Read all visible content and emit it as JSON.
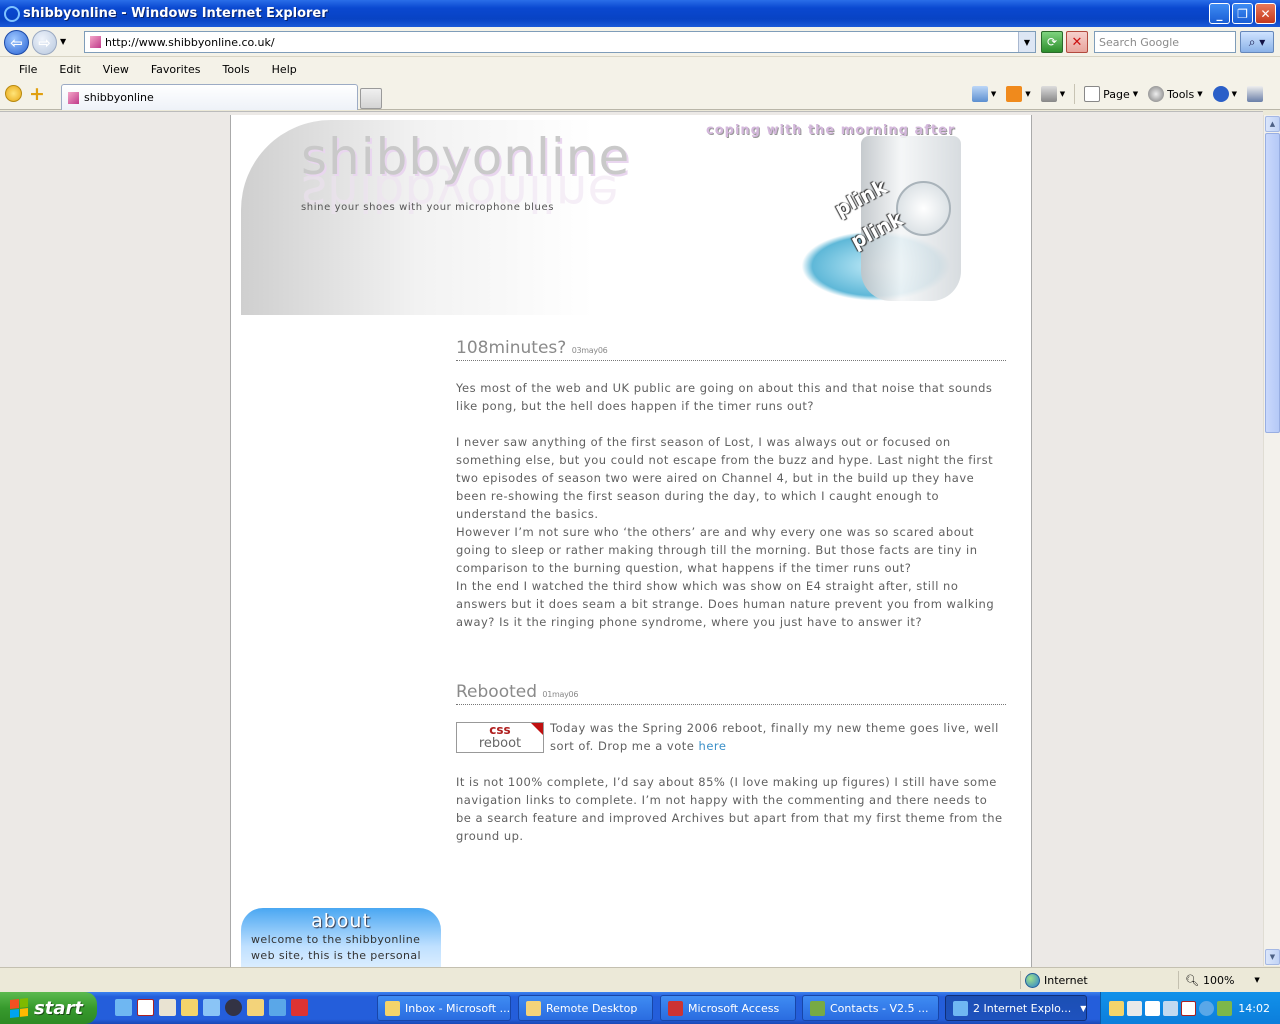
{
  "window": {
    "title": "shibbyonline - Windows Internet Explorer"
  },
  "address": {
    "url": "http://www.shibbyonline.co.uk/"
  },
  "search": {
    "placeholder": "Search Google"
  },
  "menu": [
    "File",
    "Edit",
    "View",
    "Favorites",
    "Tools",
    "Help"
  ],
  "tab": {
    "title": "shibbyonline"
  },
  "command_bar": {
    "page_label": "Page",
    "tools_label": "Tools"
  },
  "site": {
    "name": "shibbyonline",
    "tagline": "shine your shoes with your microphone blues",
    "banner_text": "coping with the morning after",
    "plink1": "plink",
    "plink2": "plink"
  },
  "posts": [
    {
      "title": "108minutes?",
      "date": "03may06",
      "paragraphs": [
        "Yes most of the web and UK public are going on about this and that noise that sounds like pong, but the hell does happen if the timer runs out?",
        "I never saw anything of the first season of Lost, I was always out or focused on something else, but you could not escape from the buzz and hype. Last night the first two episodes of season two were aired on Channel 4, but in the build up they have been re-showing the first season during the day, to which I caught enough to understand the basics.",
        "However I’m not sure who ‘the others’ are and why every one was so scared about going to sleep or rather making through till the morning. But those facts are tiny in comparison to the burning question, what happens if the timer runs out?",
        "In the end I watched the third show which was show on E4 straight after, still no answers but it does seam a bit strange. Does human nature prevent you from walking away? Is it the ringing phone syndrome, where you just have to answer it?"
      ]
    },
    {
      "title": "Rebooted",
      "date": "01may06",
      "badge_top": "css",
      "badge_bottom": "reboot",
      "intro": "Today was the Spring 2006 reboot, finally my new theme goes live, well sort of. Drop me a vote ",
      "link_text": "here",
      "paragraphs": [
        "It is not 100% complete, I’d say about 85% (I love making up figures) I still have some navigation links to complete. I’m not happy with the commenting and there needs to be a search feature and improved Archives but apart from that my first theme from the ground up."
      ]
    }
  ],
  "about": {
    "title": "about",
    "text": "welcome to the shibbyonline web site, this is the personal online"
  },
  "status": {
    "zone": "Internet",
    "zoom": "100%"
  },
  "taskbar": {
    "start": "start",
    "buttons": [
      "Inbox - Microsoft ...",
      "Remote Desktop",
      "Microsoft Access",
      "Contacts -  V2.5 ...",
      "2 Internet Explo..."
    ],
    "clock": "14:02"
  },
  "colors": {
    "title_bar": "#0843c4",
    "taskbar": "#245edb",
    "start": "#379a2d",
    "link": "#3a8fc8"
  }
}
